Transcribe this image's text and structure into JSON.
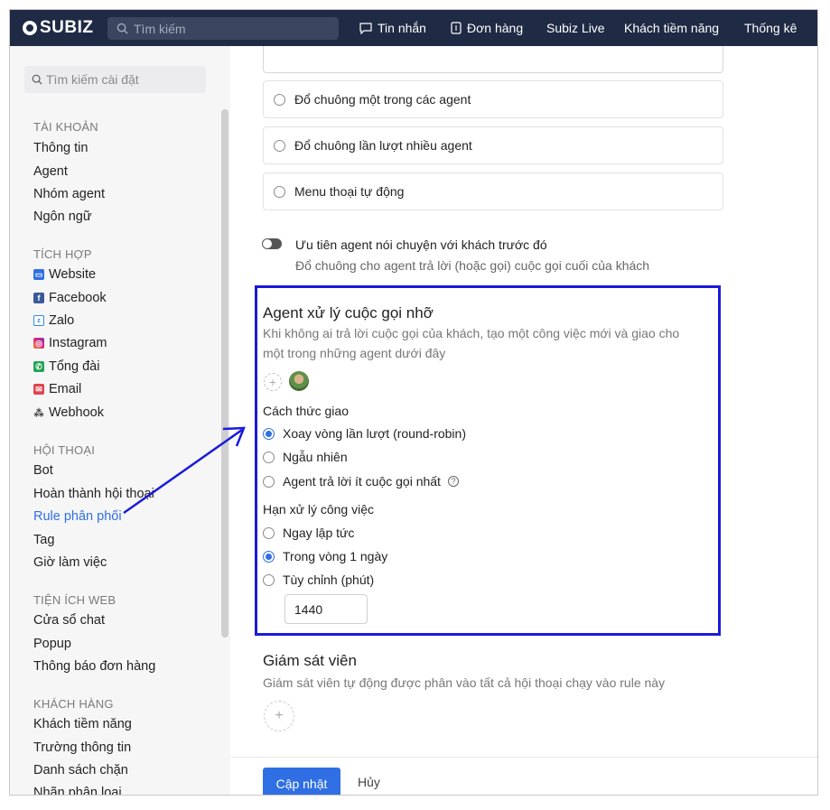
{
  "topbar": {
    "logo": "subiz",
    "search_placeholder": "Tìm kiếm",
    "nav": [
      {
        "label": "Tin nhắn",
        "icon": "chat-icon"
      },
      {
        "label": "Đơn hàng",
        "icon": "receipt-icon"
      },
      {
        "label": "Subiz Live",
        "icon": ""
      },
      {
        "label": "Khách tiềm năng",
        "icon": ""
      },
      {
        "label": "Thống kê",
        "icon": ""
      }
    ]
  },
  "sidebar": {
    "search_placeholder": "Tìm kiếm cài đặt",
    "sections": [
      {
        "title": "TÀI KHOẢN",
        "items": [
          "Thông tin",
          "Agent",
          "Nhóm agent",
          "Ngôn ngữ"
        ]
      },
      {
        "title": "TÍCH HỢP",
        "items": [
          "Website",
          "Facebook",
          "Zalo",
          "Instagram",
          "Tổng đài",
          "Email",
          "Webhook"
        ]
      },
      {
        "title": "HỘI THOẠI",
        "items": [
          "Bot",
          "Hoàn thành hội thoại",
          "Rule phân phối",
          "Tag",
          "Giờ làm việc"
        ]
      },
      {
        "title": "TIỆN ÍCH WEB",
        "items": [
          "Cửa sổ chat",
          "Popup",
          "Thông báo đơn hàng"
        ]
      },
      {
        "title": "KHÁCH HÀNG",
        "items": [
          "Khách tiềm năng",
          "Trường thông tin",
          "Danh sách chặn",
          "Nhãn phân loại"
        ]
      }
    ],
    "active_item": "Rule phân phối"
  },
  "main": {
    "ring_options": [
      "Đổ chuông một trong các agent",
      "Đổ chuông lần lượt nhiều agent",
      "Menu thoại tự động"
    ],
    "priority": {
      "title": "Ưu tiên agent nói chuyện với khách trước đó",
      "desc": "Đổ chuông cho agent trả lời (hoặc gọi) cuộc gọi cuối của khách"
    },
    "missed": {
      "title": "Agent xử lý cuộc gọi nhỡ",
      "desc_line1": "Khi không ai trả lời cuộc gọi của khách, tạo một công việc mới và giao cho",
      "desc_line2": "một trong những agent dưới đây",
      "assign_title": "Cách thức giao",
      "assign_options": [
        "Xoay vòng lần lượt (round-robin)",
        "Ngẫu nhiên",
        "Agent trả lời ít cuộc gọi nhất"
      ],
      "deadline_title": "Hạn xử lý công việc",
      "deadline_options": [
        "Ngay lập tức",
        "Trong vòng 1 ngày",
        "Tùy chỉnh (phút)"
      ],
      "minutes_value": "1440"
    },
    "supervisor": {
      "title": "Giám sát viên",
      "desc": "Giám sát viên tự động được phân vào tất cả hội thoại chạy vào rule này"
    },
    "footer": {
      "update": "Cập nhật",
      "cancel": "Hủy"
    }
  },
  "colors": {
    "topbar": "#1f2a44",
    "accent": "#2f6fe3",
    "highlight": "#1a1adb"
  }
}
